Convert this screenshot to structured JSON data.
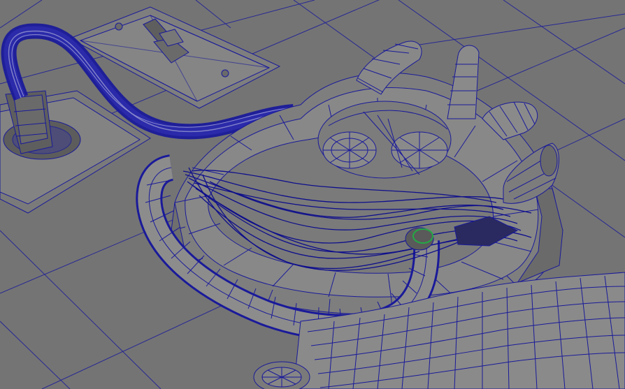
{
  "viewport": {
    "label": "",
    "colors": {
      "background": "#747474",
      "wire": "#1a1a9a",
      "wire_dense": "#0f0f8c",
      "surface_light": "#8a8a8a",
      "surface_mid": "#7a7a7a",
      "surface_dark": "#5e5e5e",
      "selection_green": "#22aa44"
    }
  },
  "scene": {
    "objects": [
      "floor-grid",
      "switch-plate",
      "toggle-lever",
      "electrical-box",
      "bundled-cable",
      "wireframe-helmet-shell",
      "helmet-gear-center",
      "helmet-antennae",
      "side-tube",
      "loose-wires",
      "green-connector",
      "neck-surface",
      "small-circular-part"
    ]
  }
}
